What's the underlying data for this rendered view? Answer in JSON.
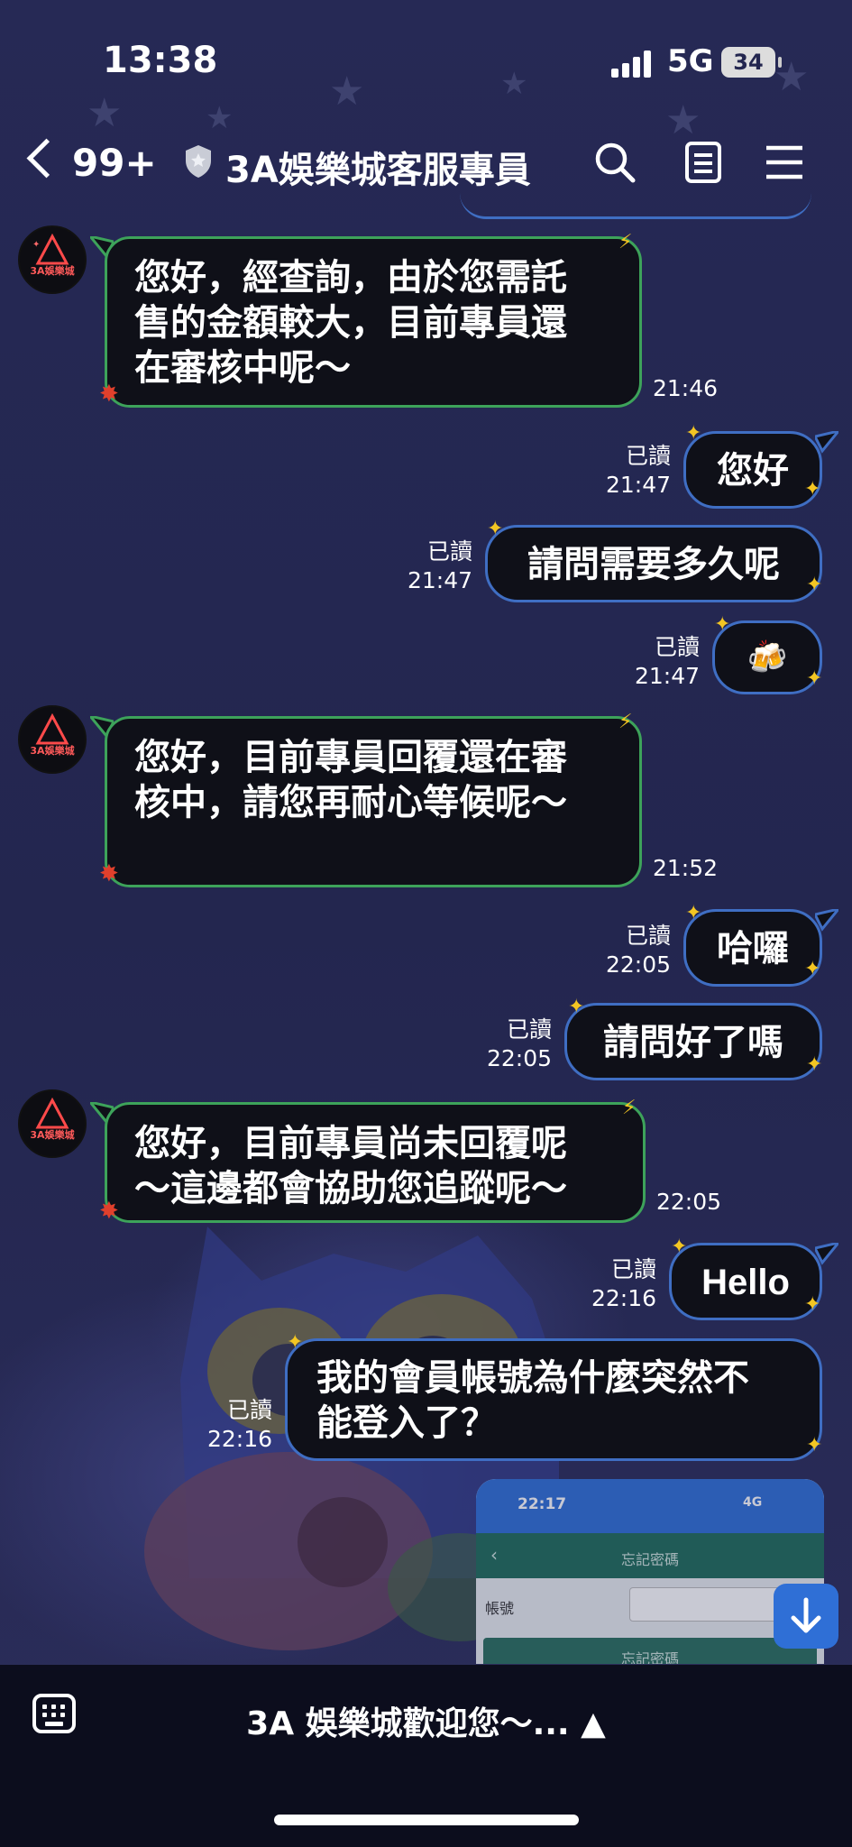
{
  "status_bar": {
    "time": "13:38",
    "network": "5G",
    "battery": "34"
  },
  "header": {
    "unread_count": "99+",
    "title": "3A娛樂城客服專員"
  },
  "avatar_label": "3A娛樂城",
  "messages": [
    {
      "type": "incoming",
      "text_lines": [
        "您好，經查詢，由於您需託",
        "售的金額較大，目前專員還",
        "在審核中呢～"
      ],
      "time": "21:46"
    },
    {
      "type": "outgoing",
      "text": "您好",
      "read": "已讀",
      "time": "21:47"
    },
    {
      "type": "outgoing",
      "text": "請問需要多久呢",
      "read": "已讀",
      "time": "21:47"
    },
    {
      "type": "outgoing",
      "text": "🍻",
      "read": "已讀",
      "time": "21:47"
    },
    {
      "type": "incoming",
      "text_lines": [
        "您好，目前專員回覆還在審",
        "核中，請您再耐心等候呢～"
      ],
      "time": "21:52"
    },
    {
      "type": "outgoing",
      "text": "哈囉",
      "read": "已讀",
      "time": "22:05"
    },
    {
      "type": "outgoing",
      "text": "請問好了嗎",
      "read": "已讀",
      "time": "22:05"
    },
    {
      "type": "incoming",
      "text_lines": [
        "您好，目前專員尚未回覆呢",
        "～這邊都會協助您追蹤呢～"
      ],
      "time": "22:05"
    },
    {
      "type": "outgoing",
      "text": "Hello",
      "read": "已讀",
      "time": "22:16"
    },
    {
      "type": "outgoing",
      "text_lines": [
        "我的會員帳號為什麼突然不",
        "能登入了？"
      ],
      "read": "已讀",
      "time": "22:16"
    }
  ],
  "screenshot_preview": {
    "time": "22:17",
    "network": "4G",
    "nav_title": "忘記密碼",
    "field_label": "帳號",
    "button_label": "忘記密碼"
  },
  "bottom_bar": {
    "menu_label": "3A 娛樂城歡迎您～... ▲"
  },
  "colors": {
    "background": "#23264f",
    "incoming_border": "#3da35a",
    "outgoing_border": "#3f6ec3",
    "bubble_fill": "#0f1018",
    "accent_blue": "#2f6fd6"
  }
}
